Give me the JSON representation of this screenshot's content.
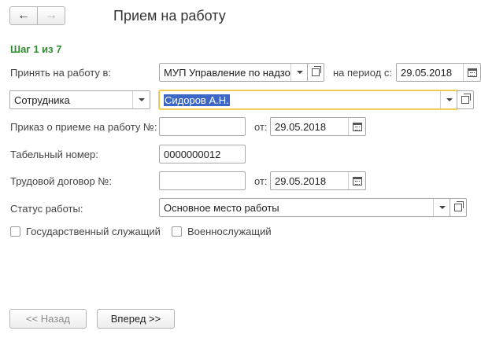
{
  "window": {
    "title": "Прием на работу"
  },
  "nav": {
    "back_icon": "←",
    "forward_icon": "→"
  },
  "step": {
    "text": "Шаг 1 из 7"
  },
  "form": {
    "hire_in_label": "Принять на работу в:",
    "organization_value": "МУП Управление по надзору",
    "period_label": "на период с:",
    "period_value": "29.05.2018",
    "employee_type_value": "Сотрудника",
    "employee_value": "Сидоров А.Н.",
    "order_label": "Приказ о приеме на работу №:",
    "order_value": "",
    "order_date_label": "от:",
    "order_date_value": "29.05.2018",
    "tab_number_label": "Табельный номер:",
    "tab_number_value": "0000000012",
    "contract_label": "Трудовой договор №:",
    "contract_value": "",
    "contract_date_label": "от:",
    "contract_date_value": "29.05.2018",
    "status_label": "Статус работы:",
    "status_value": "Основное место работы",
    "civil_servant_label": "Государственный служащий",
    "military_label": "Военнослужащий"
  },
  "footer": {
    "back_label": "<< Назад",
    "next_label": "Вперед >>"
  },
  "colors": {
    "step_green": "#2e8b2e",
    "selection_blue": "#3c67c7",
    "focus_yellow": "#e8c24a"
  }
}
